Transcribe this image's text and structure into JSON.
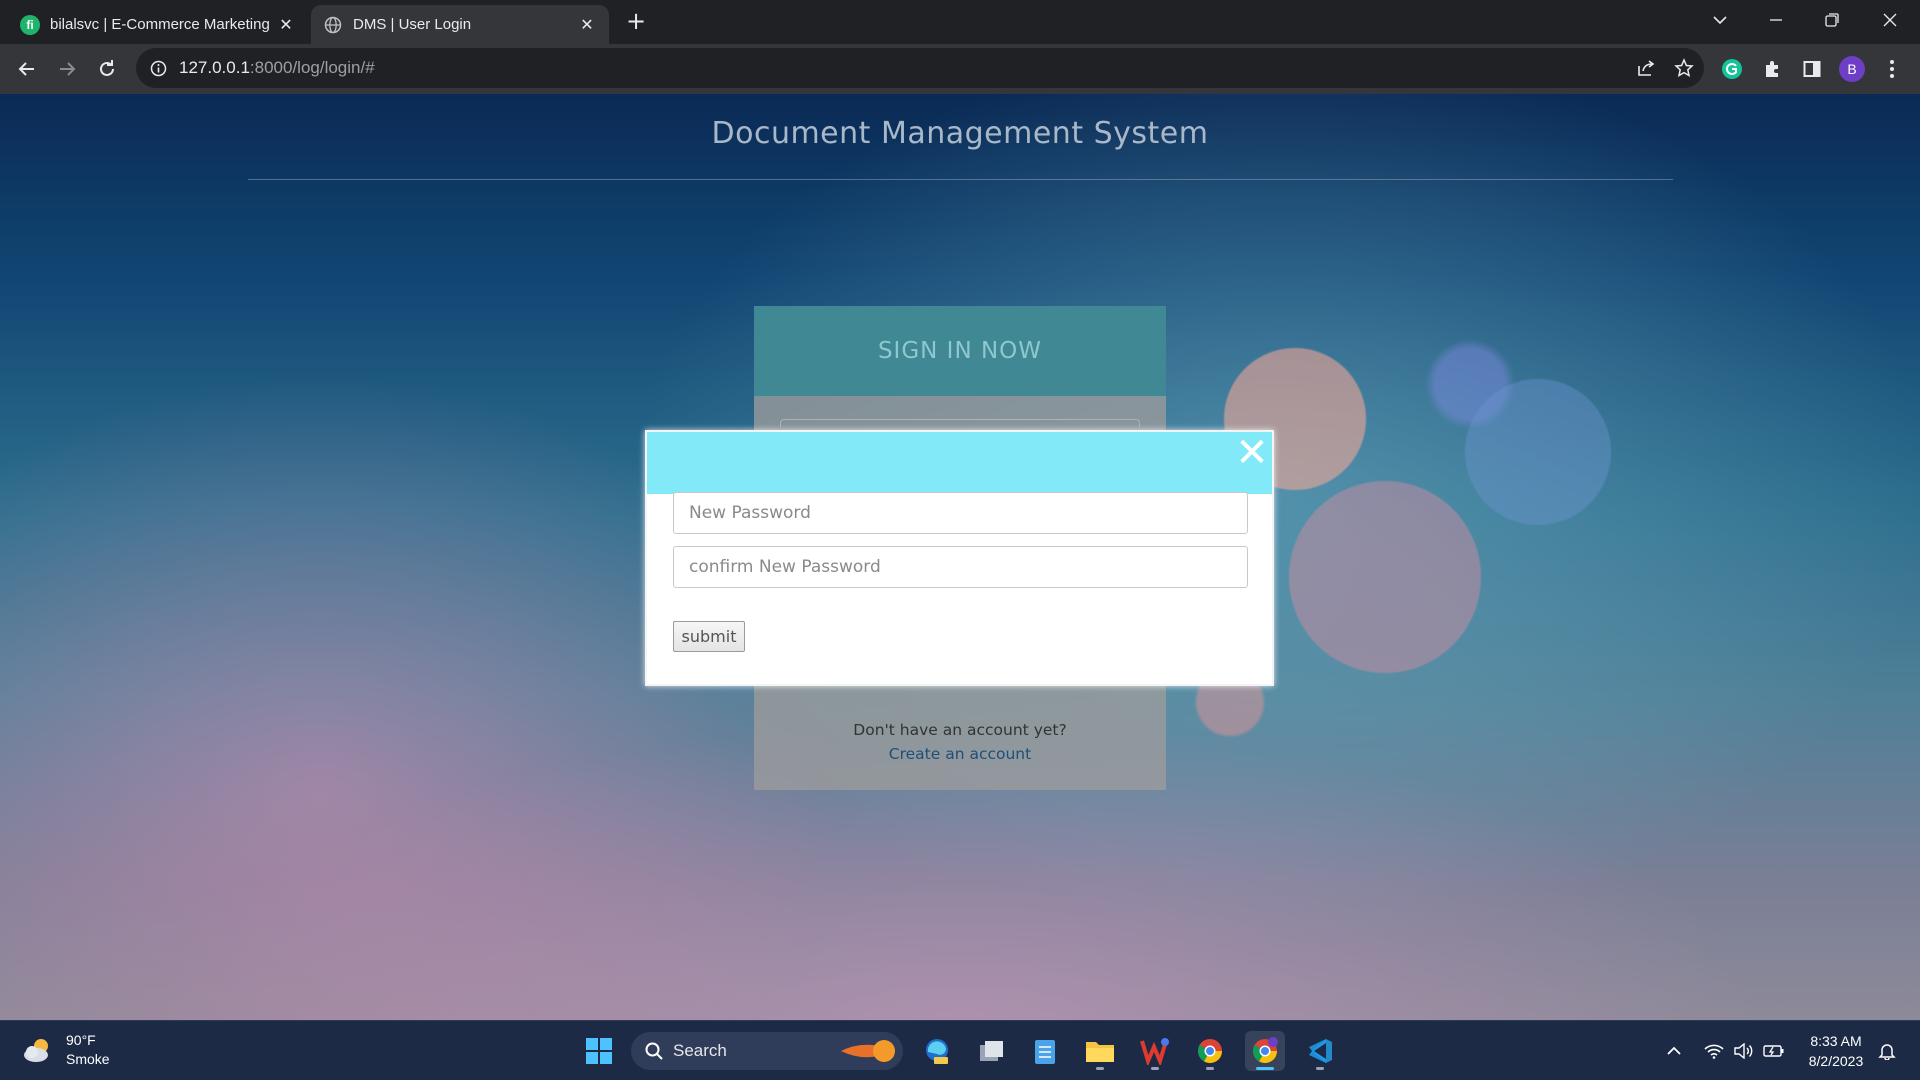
{
  "browser": {
    "tabs": [
      {
        "title": "bilalsvc | E-Commerce Marketing"
      },
      {
        "title": "DMS | User Login"
      }
    ],
    "address": {
      "host": "127.0.0.1",
      "path": ":8000/log/login/#"
    },
    "profile_initial": "B"
  },
  "page": {
    "title": "Document Management System",
    "login": {
      "heading": "SIGN IN NOW",
      "no_account_text": "Don't have an account yet?",
      "create_account_link": "Create an account"
    },
    "modal": {
      "close_glyph": "✕",
      "new_password_placeholder": "New Password",
      "confirm_password_placeholder": "confirm New Password",
      "submit_label": "submit"
    }
  },
  "taskbar": {
    "weather": {
      "temp": "90°F",
      "condition": "Smoke"
    },
    "search_label": "Search",
    "clock": {
      "time": "8:33 AM",
      "date": "8/2/2023"
    }
  },
  "colors": {
    "modal_header": "#82e9f8",
    "login_header": "#3f8894",
    "chrome_dark": "#202124",
    "taskbar": "#1c2a45"
  }
}
